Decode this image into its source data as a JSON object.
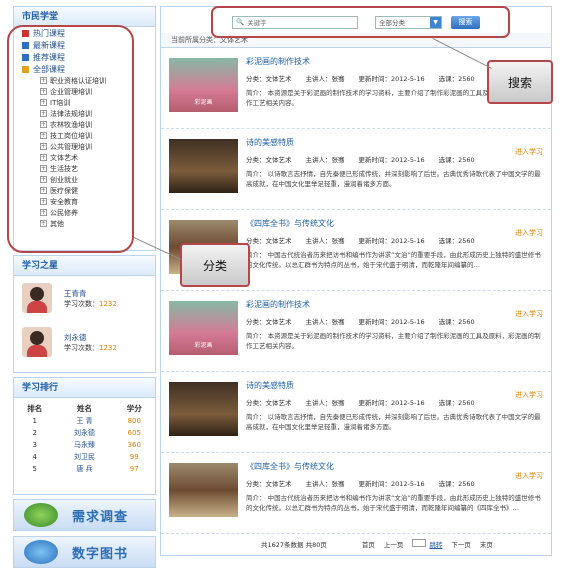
{
  "sidebar": {
    "title": "市民学堂",
    "top_categories": [
      {
        "label": "热门课程",
        "color": "#d03030"
      },
      {
        "label": "最新课程",
        "color": "#3070c0"
      },
      {
        "label": "推荐课程",
        "color": "#3070c0"
      },
      {
        "label": "全部课程",
        "color": "#e0a020"
      }
    ],
    "sub_categories": [
      "职业资格认证培训",
      "企业管理培训",
      "IT培训",
      "法律法规培训",
      "农林牧渔培训",
      "技工岗位培训",
      "公共管理培训",
      "文体艺术",
      "生活技艺",
      "创业就业",
      "医疗保健",
      "安全教育",
      "公民修养",
      "其他"
    ],
    "stars_title": "学习之星",
    "stars": [
      {
        "name": "王青青",
        "count_label": "学习次数：",
        "count": "1232"
      },
      {
        "name": "刘永德",
        "count_label": "学习次数：",
        "count": "1232"
      }
    ],
    "rank_title": "学习排行",
    "rank_headers": [
      "排名",
      "姓名",
      "学分"
    ],
    "rank_rows": [
      [
        "1",
        "王 青",
        "800"
      ],
      [
        "2",
        "刘永德",
        "605"
      ],
      [
        "3",
        "马永臻",
        "360"
      ],
      [
        "4",
        "刘卫民",
        "99"
      ],
      [
        "5",
        "唐 兵",
        "97"
      ]
    ],
    "banners": [
      "需求调查",
      "数字图书"
    ]
  },
  "search": {
    "placeholder": "关键字",
    "select_value": "全部分类",
    "button_label": "搜索"
  },
  "breadcrumb": "当前所属分类：文体艺术",
  "items": [
    {
      "title": "彩泥画的制作技术",
      "category": "分类：文体艺术",
      "teacher": "主讲人：张骞",
      "updated": "更新时间：2012-5-16",
      "views": "选课：2560",
      "enter": "进入学习",
      "desc": "简介：    本资源是关于彩泥画的制作技术的学习资料，主要介绍了制作彩泥画的工具及原料，彩泥画的制作工艺相关内容。",
      "thumb": "t1",
      "thumb_caption": "彩泥画"
    },
    {
      "title": "诗的美感特质",
      "category": "分类：文体艺术",
      "teacher": "主讲人：张骞",
      "updated": "更新时间：2012-5-16",
      "views": "选课：2560",
      "enter": "进入学习",
      "desc": "简介：    以诗歌言志抒情，自先秦便已形成传统，并深刻影响了后世。古典优秀诗歌代表了中国文学的最高成就，在中国文化里举足轻重，漫润着诸多方面。",
      "thumb": "t2",
      "thumb_caption": ""
    },
    {
      "title": "《四库全书》与传统文化",
      "category": "分类：文体艺术",
      "teacher": "主讲人：张骞",
      "updated": "更新时间：2012-5-16",
      "views": "选课：2560",
      "enter": "进入学习",
      "desc": "简介：    中国古代统治者历来把访书和编书作为讲求“文治”的重要手段，由此形成历史上独特的盛世修书的文化传统。以总汇群书为特点的丛书，始于宋代盛于明清，而乾隆年间编纂的…",
      "thumb": "t3",
      "thumb_caption": ""
    },
    {
      "title": "彩泥画的制作技术",
      "category": "分类：文体艺术",
      "teacher": "主讲人：张骞",
      "updated": "更新时间：2012-5-16",
      "views": "选课：2560",
      "enter": "进入学习",
      "desc": "简介：    本资源是关于彩泥画的制作技术的学习资料，主要介绍了制作彩泥画的工具及原料，彩泥画的制作工艺相关内容。",
      "thumb": "t1",
      "thumb_caption": "彩泥画"
    },
    {
      "title": "诗的美感特质",
      "category": "分类：文体艺术",
      "teacher": "主讲人：张骞",
      "updated": "更新时间：2012-5-16",
      "views": "选课：2560",
      "enter": "进入学习",
      "desc": "简介：    以诗歌言志抒情，自先秦便已形成传统，并深刻影响了后世。古典优秀诗歌代表了中国文学的最高成就，在中国文化里举足轻重，漫润着诸多方面。",
      "thumb": "t2",
      "thumb_caption": ""
    },
    {
      "title": "《四库全书》与传统文化",
      "category": "分类：文体艺术",
      "teacher": "主讲人：张骞",
      "updated": "更新时间：2012-5-16",
      "views": "选课：2560",
      "enter": "进入学习",
      "desc": "简介：    中国古代统治者历来把访书和编书作为讲求“文治”的重要手段，由此形成历史上独特的盛世修书的文化传统。以总汇群书为特点的丛书，始于宋代盛于明清，而乾隆年间编纂的《四库全书》…",
      "thumb": "t3",
      "thumb_caption": ""
    }
  ],
  "pager": {
    "total": "共1627条数据  共80页",
    "first": "首页",
    "prev": "上一页",
    "go": "跳转",
    "next": "下一页",
    "last": "末页"
  },
  "callouts": {
    "search": "搜索",
    "category": "分类"
  }
}
